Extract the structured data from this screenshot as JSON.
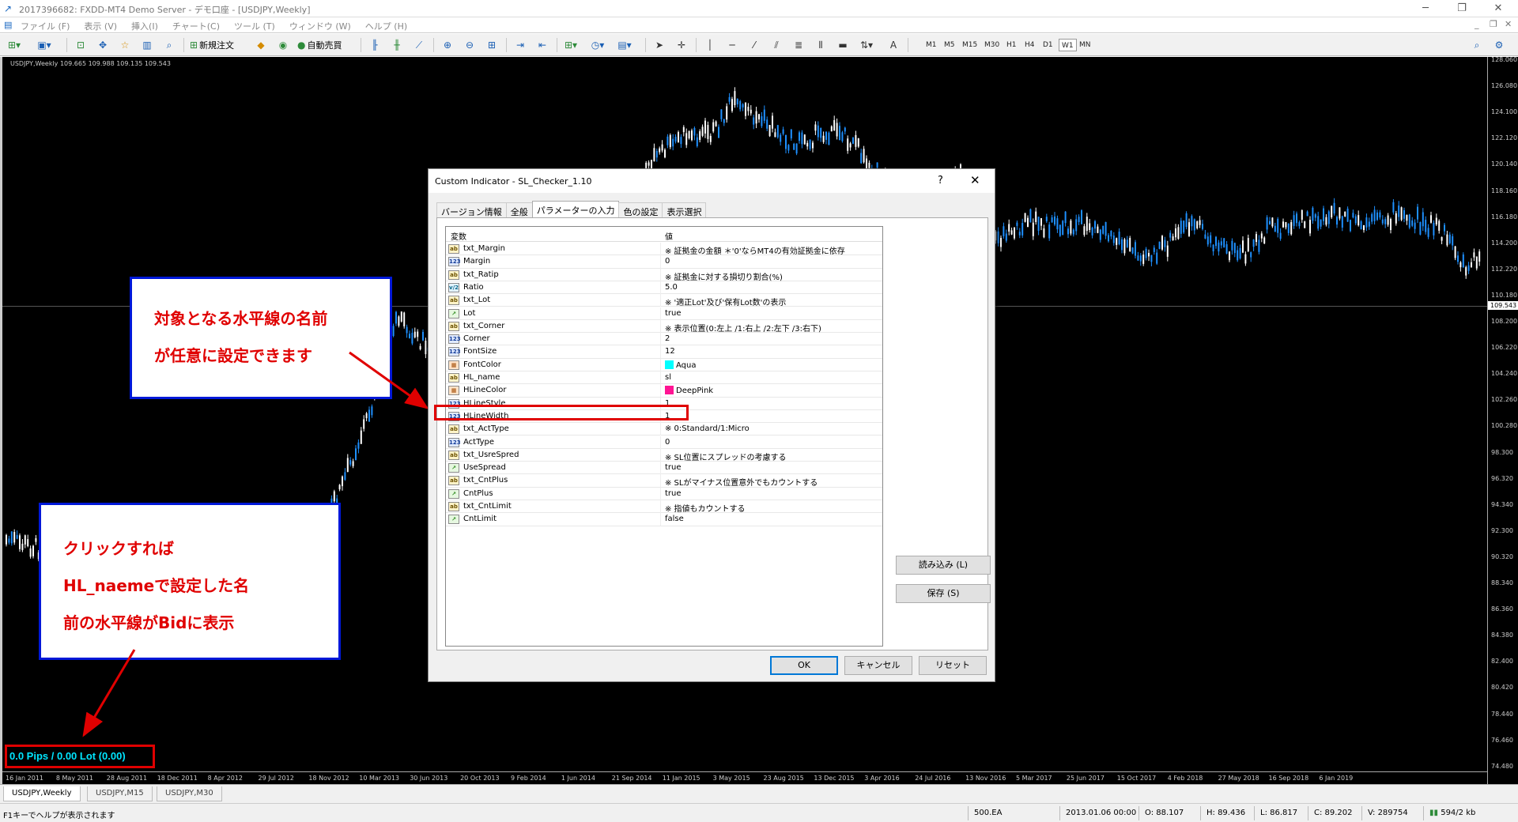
{
  "titlebar": {
    "title": "2017396682: FXDD-MT4 Demo Server - デモ口座 - [USDJPY,Weekly]",
    "minimize": "─",
    "restore": "❐",
    "close": "✕"
  },
  "menubar": {
    "items": [
      "ファイル (F)",
      "表示 (V)",
      "挿入(I)",
      "チャート(C)",
      "ツール (T)",
      "ウィンドウ (W)",
      "ヘルプ (H)"
    ],
    "mdi_minimize": "_",
    "mdi_restore": "❐",
    "mdi_close": "✕"
  },
  "toolbar": {
    "new_order": "新規注文",
    "auto_trading": "自動売買",
    "timeframes": [
      "M1",
      "M5",
      "M15",
      "M30",
      "H1",
      "H4",
      "D1",
      "W1",
      "MN"
    ],
    "active_timeframe": "W1",
    "text_tool": "A"
  },
  "chart": {
    "info": "USDJPY,Weekly  109.665 109.988 109.135 109.543",
    "current_price": "109.543",
    "price_labels": [
      "128.060",
      "126.080",
      "124.100",
      "122.120",
      "120.140",
      "118.160",
      "116.180",
      "114.200",
      "112.220",
      "110.180",
      "108.200",
      "106.220",
      "104.240",
      "102.260",
      "100.280",
      "98.300",
      "96.320",
      "94.340",
      "92.300",
      "90.320",
      "88.340",
      "86.360",
      "84.380",
      "82.400",
      "80.420",
      "78.440",
      "76.460",
      "74.480"
    ],
    "date_labels": [
      "16 Jan 2011",
      "8 May 2011",
      "28 Aug 2011",
      "18 Dec 2011",
      "8 Apr 2012",
      "29 Jul 2012",
      "18 Nov 2012",
      "10 Mar 2013",
      "30 Jun 2013",
      "20 Oct 2013",
      "9 Feb 2014",
      "1 Jun 2014",
      "21 Sep 2014",
      "11 Jan 2015",
      "3 May 2015",
      "23 Aug 2015",
      "13 Dec 2015",
      "3 Apr 2016",
      "24 Jul 2016",
      "13 Nov 2016",
      "5 Mar 2017",
      "25 Jun 2017",
      "15 Oct 2017",
      "4 Feb 2018",
      "27 May 2018",
      "16 Sep 2018",
      "6 Jan 2019"
    ],
    "sl_text": "0.0 Pips / 0.00 Lot (0.00)"
  },
  "annotations": {
    "top": [
      "対象となる水平線の名前",
      "が任意に設定できます"
    ],
    "bottom": [
      "クリックすれば",
      "HL_naemeで設定した名",
      "前の水平線がBidに表示"
    ]
  },
  "dialog": {
    "title": "Custom Indicator - SL_Checker_1.10",
    "help": "?",
    "close": "✕",
    "tabs": [
      "バージョン情報",
      "全般",
      "パラメーターの入力",
      "色の設定",
      "表示選択"
    ],
    "active_tab": "パラメーターの入力",
    "col_variable": "変数",
    "col_value": "値",
    "params": [
      {
        "type": "str",
        "icon": "ab",
        "name": "txt_Margin",
        "value": "※ 証拠金の金額 ＊'0'ならMT4の有効証拠金に依存"
      },
      {
        "type": "int",
        "icon": "123",
        "name": "Margin",
        "value": "0"
      },
      {
        "type": "str",
        "icon": "ab",
        "name": "txt_Ratip",
        "value": "※ 証拠金に対する損切り割合(%)"
      },
      {
        "type": "dbl",
        "icon": "v/2",
        "name": "Ratio",
        "value": "5.0"
      },
      {
        "type": "str",
        "icon": "ab",
        "name": "txt_Lot",
        "value": "※ '適正Lot'及び'保有Lot数'の表示"
      },
      {
        "type": "bool",
        "icon": "↗",
        "name": "Lot",
        "value": "true"
      },
      {
        "type": "str",
        "icon": "ab",
        "name": "txt_Corner",
        "value": "※ 表示位置(0:左上 /1:右上 /2:左下 /3:右下)"
      },
      {
        "type": "int",
        "icon": "123",
        "name": "Corner",
        "value": "2"
      },
      {
        "type": "int",
        "icon": "123",
        "name": "FontSize",
        "value": "12"
      },
      {
        "type": "col",
        "icon": "▦",
        "name": "FontColor",
        "value": "Aqua",
        "swatch": "#00ffff"
      },
      {
        "type": "str",
        "icon": "ab",
        "name": "HL_name",
        "value": "sl"
      },
      {
        "type": "col",
        "icon": "▦",
        "name": "HLineColor",
        "value": "DeepPink",
        "swatch": "#ff1493"
      },
      {
        "type": "int",
        "icon": "123",
        "name": "HLineStyle",
        "value": "1"
      },
      {
        "type": "int",
        "icon": "123",
        "name": "HLineWidth",
        "value": "1"
      },
      {
        "type": "str",
        "icon": "ab",
        "name": "txt_ActType",
        "value": "※ 0:Standard/1:Micro"
      },
      {
        "type": "int",
        "icon": "123",
        "name": "ActType",
        "value": "0"
      },
      {
        "type": "str",
        "icon": "ab",
        "name": "txt_UsreSpred",
        "value": "※ SL位置にスプレッドの考慮する"
      },
      {
        "type": "bool",
        "icon": "↗",
        "name": "UseSpread",
        "value": "true"
      },
      {
        "type": "str",
        "icon": "ab",
        "name": "txt_CntPlus",
        "value": "※ SLがマイナス位置意外でもカウントする"
      },
      {
        "type": "bool",
        "icon": "↗",
        "name": "CntPlus",
        "value": "true"
      },
      {
        "type": "str",
        "icon": "ab",
        "name": "txt_CntLimit",
        "value": "※ 指値もカウントする"
      },
      {
        "type": "bool",
        "icon": "↗",
        "name": "CntLimit",
        "value": "false"
      }
    ],
    "load_button": "読み込み (L)",
    "save_button": "保存 (S)",
    "ok_button": "OK",
    "cancel_button": "キャンセル",
    "reset_button": "リセット"
  },
  "chart_tabs": [
    "USDJPY,Weekly",
    "USDJPY,M15",
    "USDJPY,M30"
  ],
  "statusbar": {
    "help": "F1キーでヘルプが表示されます",
    "profile": "500.EA",
    "datetime": "2013.01.06 00:00",
    "open": "O: 88.107",
    "high": "H: 89.436",
    "low": "L: 86.817",
    "close": "C: 89.202",
    "volume": "V: 289754",
    "connection": "594/2 kb"
  },
  "colors": {
    "candle_up": "#1e90ff",
    "candle_down": "#ffffff",
    "annotation_border": "#0018d8",
    "annotation_text": "#e00000",
    "highlight": "#e00000",
    "sl_text": "#00e5ff"
  }
}
